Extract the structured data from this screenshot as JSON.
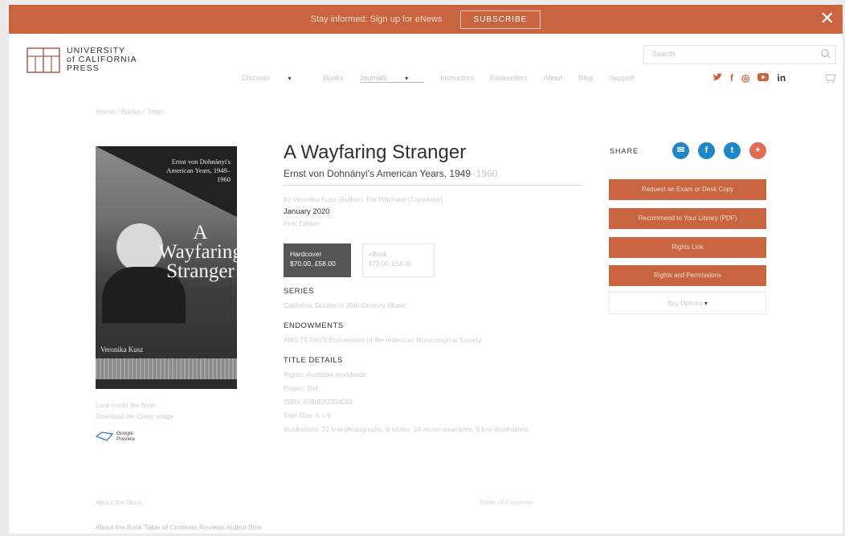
{
  "banner": {
    "text": "Stay informed: Sign up for eNews",
    "subscribe_label": "SUBSCRIBE",
    "close_glyph": "✕"
  },
  "logo": {
    "line1": "UNIVERSITY",
    "line2": "of CALIFORNIA",
    "line3": "PRESS"
  },
  "search": {
    "placeholder": "Search"
  },
  "nav": [
    {
      "label": "Discover"
    },
    {
      "label": "Books"
    },
    {
      "label": "Journals"
    },
    {
      "label": "Instructors"
    },
    {
      "label": "Booksellers"
    },
    {
      "label": "About"
    },
    {
      "label": "Blog"
    },
    {
      "label": "Support"
    }
  ],
  "nav_carets": "▾",
  "social_top": [
    "twitter-icon",
    "facebook-icon",
    "instagram-icon",
    "youtube-icon",
    "linkedin-icon"
  ],
  "social_glyphs": {
    "twitter": "🐦",
    "facebook": "f",
    "instagram": "◎",
    "youtube": "▶",
    "linkedin": "in"
  },
  "breadcrumbs": "Home  /  Books  /  Titles",
  "book": {
    "cover_subtitle": "Ernst von Dohnányi's American Years, 1949–1960",
    "cover_title_line1": "A Wayfaring",
    "cover_title_line2": "Stranger",
    "cover_author": "Veronika Kusz",
    "title": "A Wayfaring Stranger",
    "subtitle_main": "Ernst von Dohnányi's American Years, 1949",
    "subtitle_tail": "–1960",
    "by_line": "by Veronika Kusz (Author), Pál Pritchard (Translator)",
    "date": "January 2020",
    "date_sub": "First Edition",
    "hardcover_label": "Hardcover",
    "hardcover_price": "$70.00, £58.00",
    "ebook_label": "eBook",
    "ebook_price": "$70.00, £58.00",
    "series_head": "SERIES",
    "series_line": "California Studies in 20th-Century Music",
    "endow_head": "ENDOWMENTS",
    "endow_line": "AMS 75 PAYS Endowment of the American Musicological Society",
    "details_head": "TITLE DETAILS",
    "details_lines": [
      "Rights: Available worldwide",
      "Pages: 264",
      "ISBN: 9780520304048",
      "Trim Size: 6 x 9",
      "Illustrations: 22 b-w photographs, 6 tables, 24 music examples, 5 b-w illustrations"
    ],
    "under_cover_1": "Look Inside the Book",
    "under_cover_2": "Download the Cover Image",
    "google_1": "Google",
    "google_2": "Preview"
  },
  "share": {
    "label": "SHARE",
    "icons": [
      "email-icon",
      "facebook-icon",
      "twitter-icon",
      "plus-icon"
    ],
    "colors": [
      "#1f86c7",
      "#1f86c7",
      "#1f86c7",
      "#e26b55"
    ],
    "glyphs": [
      "✉",
      "f",
      "t",
      "+"
    ]
  },
  "actions": [
    {
      "label": "Request an Exam or Desk Copy"
    },
    {
      "label": "Recommend to Your Library (PDF)"
    },
    {
      "label": "Rights Link"
    },
    {
      "label": "Rights and Permissions"
    }
  ],
  "actions_more": "Buy Options",
  "footer": {
    "line1": "About the Book",
    "line2": "Table of Contents",
    "tabs": "About the Book   Table of Contents   Reviews   Author Bios"
  },
  "colors": {
    "brand": "#c8643f",
    "share_blue": "#1f86c7",
    "share_red": "#e26b55"
  }
}
